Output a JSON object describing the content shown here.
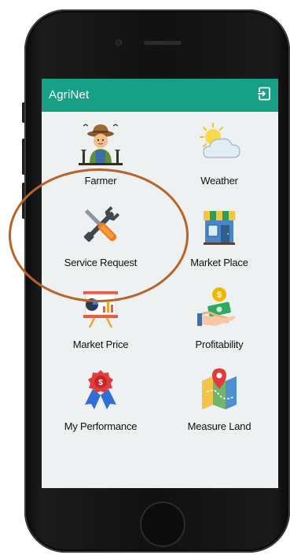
{
  "app": {
    "title": "AgriNet"
  },
  "colors": {
    "appbar": "#16a085",
    "screen_bg": "#eef1f1",
    "annotation": "#b8632a"
  },
  "appbar": {
    "logout_icon": "logout-icon"
  },
  "menu": [
    {
      "label": "Farmer",
      "icon": "farmer-icon"
    },
    {
      "label": "Weather",
      "icon": "weather-icon"
    },
    {
      "label": "Service Request",
      "icon": "tools-icon"
    },
    {
      "label": "Market Place",
      "icon": "shop-icon"
    },
    {
      "label": "Market Price",
      "icon": "price-chart-icon"
    },
    {
      "label": "Profitability",
      "icon": "profit-money-icon"
    },
    {
      "label": "My Performance",
      "icon": "award-ribbon-icon"
    },
    {
      "label": "Measure Land",
      "icon": "map-location-icon"
    }
  ]
}
